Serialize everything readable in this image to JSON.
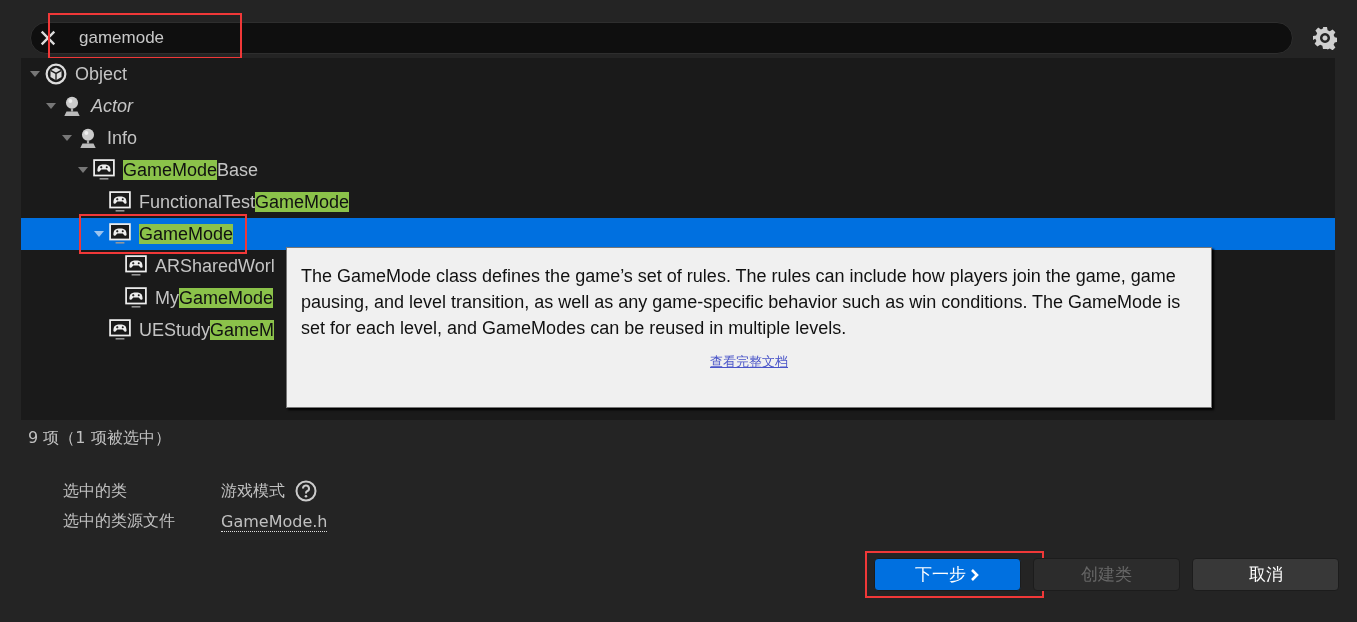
{
  "search": {
    "value": "gamemode",
    "highlighted": true
  },
  "tree": [
    {
      "parts": [
        {
          "text": "Object",
          "match": false
        }
      ],
      "kind": "cube",
      "italic": false,
      "expanded": true,
      "selected": false,
      "highlighted": false,
      "children": [
        {
          "parts": [
            {
              "text": "Actor",
              "match": false
            }
          ],
          "kind": "actor",
          "italic": true,
          "expanded": true,
          "selected": false,
          "highlighted": false,
          "children": [
            {
              "parts": [
                {
                  "text": "Info",
                  "match": false
                }
              ],
              "kind": "actor",
              "italic": false,
              "expanded": true,
              "selected": false,
              "highlighted": false,
              "children": [
                {
                  "parts": [
                    {
                      "text": "GameMode",
                      "match": true
                    },
                    {
                      "text": "Base",
                      "match": false
                    }
                  ],
                  "kind": "gamepad",
                  "italic": false,
                  "expanded": true,
                  "selected": false,
                  "highlighted": false,
                  "children": [
                    {
                      "parts": [
                        {
                          "text": "FunctionalTest",
                          "match": false
                        },
                        {
                          "text": "GameMode",
                          "match": true
                        }
                      ],
                      "kind": "gamepad",
                      "italic": false,
                      "selected": false,
                      "highlighted": false
                    },
                    {
                      "parts": [
                        {
                          "text": "GameMode",
                          "match": true
                        }
                      ],
                      "kind": "gamepad",
                      "italic": false,
                      "expanded": true,
                      "selected": true,
                      "highlighted": true,
                      "children": [
                        {
                          "parts": [
                            {
                              "text": "ARSharedWorl",
                              "match": false
                            }
                          ],
                          "kind": "gamepad",
                          "italic": false,
                          "selected": false,
                          "highlighted": false
                        },
                        {
                          "parts": [
                            {
                              "text": "My",
                              "match": false
                            },
                            {
                              "text": "GameMode",
                              "match": true
                            }
                          ],
                          "kind": "gamepad",
                          "italic": false,
                          "selected": false,
                          "highlighted": false
                        }
                      ]
                    },
                    {
                      "parts": [
                        {
                          "text": "UEStudy",
                          "match": false
                        },
                        {
                          "text": "GameM",
                          "match": true
                        }
                      ],
                      "kind": "gamepad",
                      "italic": false,
                      "selected": false,
                      "highlighted": false
                    }
                  ]
                }
              ]
            }
          ]
        }
      ]
    }
  ],
  "tooltip": {
    "text": "The GameMode class defines the game’s set of rules. The rules can include how players join the game, game pausing, and level transition, as well as any game-specific behavior such as win conditions. The GameMode is set for each level, and GameModes can be reused in multiple levels.",
    "link": "查看完整文档"
  },
  "status": "9 项（1 项被选中）",
  "properties": [
    {
      "label": "选中的类",
      "value": "游戏模式",
      "help": true,
      "link": false
    },
    {
      "label": "选中的类源文件",
      "value": "GameMode.h",
      "help": false,
      "link": true
    }
  ],
  "buttons": [
    {
      "label": "下一步",
      "kind": "primary",
      "disabled": false,
      "highlighted": true
    },
    {
      "label": "创建类",
      "kind": "normal",
      "disabled": true,
      "highlighted": false
    },
    {
      "label": "取消",
      "kind": "normal",
      "disabled": false,
      "highlighted": false
    }
  ]
}
